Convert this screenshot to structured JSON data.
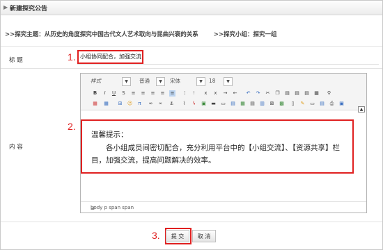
{
  "header": {
    "title": "新建探究公告",
    "arrow": "▶"
  },
  "info": {
    "topic_label": ">>探究主题：",
    "topic_value": "从历史的角度探究中国古代文人艺术取向与昆曲兴衰的关系",
    "group_label": ">>探究小组：",
    "group_value": "探究一组"
  },
  "form": {
    "title_label": "标 题",
    "title_value": "小组协同配合，加强交流",
    "content_label": "内 容",
    "markers": {
      "one": "1.",
      "two": "2.",
      "three": "3."
    }
  },
  "editor": {
    "style_select": "样式",
    "format_select": "普通",
    "font_select": "宋体",
    "size_select": "18",
    "content_title": "温馨提示：",
    "content_body": "各小组成员间密切配合，充分利用平台中的【小组交流】、【资源共享】栏目，加强交流，提高问题解决的效率。",
    "status_path": "body  p  span  span"
  },
  "buttons": {
    "submit": "提 交",
    "cancel": "取 消"
  },
  "colors": {
    "marker": "#e02020"
  }
}
